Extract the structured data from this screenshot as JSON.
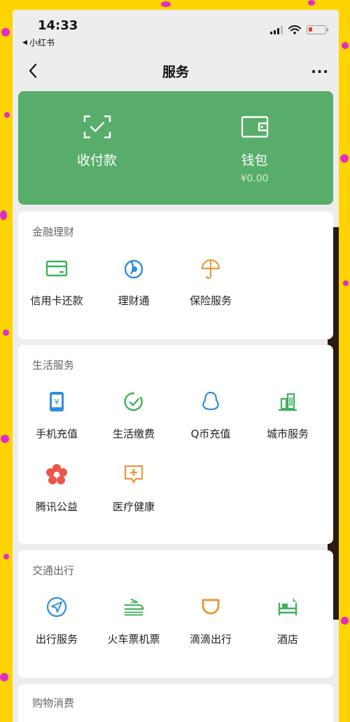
{
  "status_bar": {
    "time": "14:33",
    "back_app": "小红书"
  },
  "nav": {
    "title": "服务",
    "more": "···"
  },
  "wallet": {
    "pay": {
      "label": "收付款",
      "icon": "scan-pay-icon"
    },
    "purse": {
      "label": "钱包",
      "balance": "¥0.00",
      "icon": "wallet-icon"
    }
  },
  "sections": {
    "finance": {
      "title": "金融理财",
      "items": [
        {
          "label": "信用卡还款",
          "icon": "credit-card-icon"
        },
        {
          "label": "理财通",
          "icon": "wealth-icon"
        },
        {
          "label": "保险服务",
          "icon": "umbrella-icon"
        }
      ]
    },
    "life": {
      "title": "生活服务",
      "items": [
        {
          "label": "手机充值",
          "icon": "phone-recharge-icon"
        },
        {
          "label": "生活缴费",
          "icon": "bill-pay-icon"
        },
        {
          "label": "Q币充值",
          "icon": "penguin-icon"
        },
        {
          "label": "城市服务",
          "icon": "city-icon"
        },
        {
          "label": "腾讯公益",
          "icon": "charity-flower-icon"
        },
        {
          "label": "医疗健康",
          "icon": "medical-icon"
        }
      ]
    },
    "transport": {
      "title": "交通出行",
      "items": [
        {
          "label": "出行服务",
          "icon": "navigation-icon"
        },
        {
          "label": "火车票机票",
          "icon": "train-plane-icon"
        },
        {
          "label": "滴滴出行",
          "icon": "didi-icon"
        },
        {
          "label": "酒店",
          "icon": "hotel-bed-icon"
        }
      ]
    },
    "shopping": {
      "title": "购物消费"
    }
  },
  "colors": {
    "green_card": "#58ad6a",
    "accent_green": "#3fb15a",
    "accent_blue": "#2f8fde",
    "accent_orange": "#e89a3c",
    "accent_red": "#e8574a",
    "background_yellow": "#ffd400",
    "dot_magenta": "#e22cc6"
  }
}
